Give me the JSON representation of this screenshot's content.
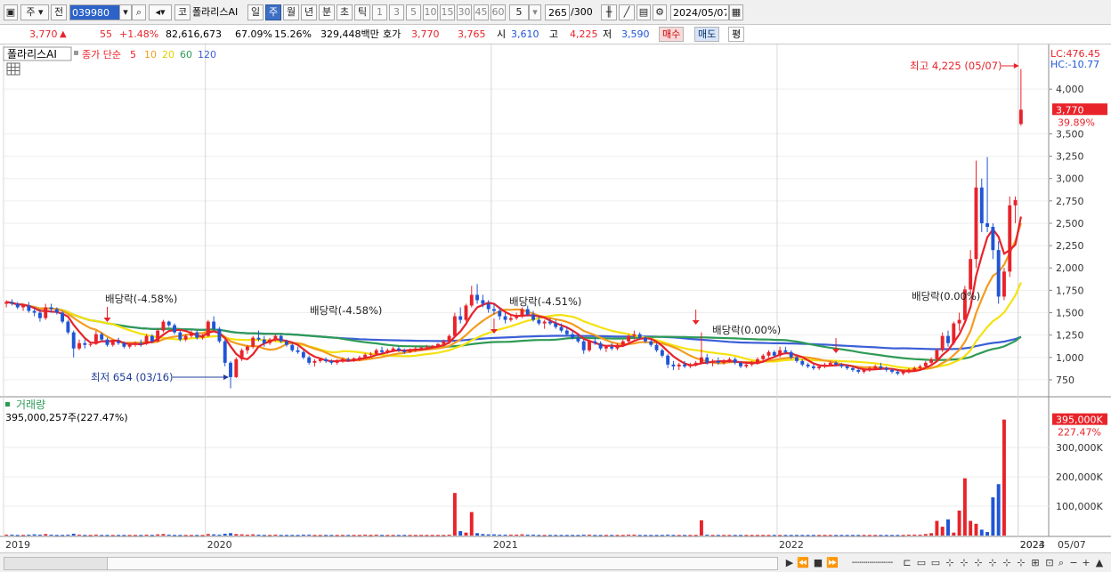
{
  "toolbar": {
    "market": "주",
    "jeon": "전",
    "code": "039980",
    "ko_label": "코",
    "stock_name": "폴라리스AI",
    "periods": [
      "일",
      "주",
      "월",
      "년",
      "분",
      "초",
      "틱"
    ],
    "active_period": "주",
    "intervals": [
      "1",
      "3",
      "5",
      "10",
      "15",
      "30",
      "45",
      "60"
    ],
    "interval_select": "5",
    "bar_count": "265",
    "bar_total": "/300",
    "date": "2024/05/07"
  },
  "quote": {
    "price": "3,770",
    "arrow": "▲",
    "change": "55",
    "change_pct": "+1.48%",
    "volume": "82,616,673",
    "vol_ratio": "67.09%",
    "turnover": "15.26%",
    "amount": "329,448백만",
    "hoga_label": "호가",
    "hoga1": "3,770",
    "hoga2": "3,765",
    "open_label": "시",
    "open": "3,610",
    "high_label": "고",
    "high": "4,225",
    "low_label": "저",
    "low": "3,590",
    "buy": "매수",
    "sell": "매도",
    "eval": "평"
  },
  "legend": {
    "name": "폴라리스AI",
    "ma_prefix": "종가 단순",
    "ma_periods": [
      "5",
      "10",
      "20",
      "60",
      "120"
    ],
    "lc": "LC:476.45",
    "hc": "HC:-10.77",
    "volume_title": "거래량",
    "volume_last": "395,000,257주(227.47%)"
  },
  "colors": {
    "up": "#e8232a",
    "down": "#1f55d6",
    "ma5": "#e8232a",
    "ma10": "#f39c1f",
    "ma20": "#f4e20f",
    "ma60": "#2e9b56",
    "ma120": "#3b5fd7"
  },
  "chart_data": {
    "type": "candlestick",
    "x_labels": [
      "2019",
      "2020",
      "2021",
      "2022",
      "2023",
      "2024",
      "05/07"
    ],
    "y_ticks": [
      "750",
      "1,000",
      "1,250",
      "1,500",
      "1,750",
      "2,000",
      "2,250",
      "2,500",
      "2,750",
      "3,000",
      "3,250",
      "3,500",
      "4,000"
    ],
    "ylim": [
      600,
      4300
    ],
    "current_price": "3,770",
    "current_pct": "39.89%",
    "annotations": [
      {
        "text": "최고 4,225 (05/07)",
        "value": 4225
      },
      {
        "text": "최저 654 (03/16)",
        "value": 654
      },
      {
        "text": "배당락(-4.58%)"
      },
      {
        "text": "배당락(-4.58%)"
      },
      {
        "text": "배당락(-4.51%)"
      },
      {
        "text": "배당락(0.00%)"
      },
      {
        "text": "배당락(0.00%)"
      }
    ],
    "volume_ticks": [
      "100,000K",
      "200,000K",
      "300,000K"
    ],
    "volume_last_label": "395,000K",
    "volume_last_pct": "227.47%",
    "volume_ylim": [
      0,
      400000
    ],
    "candles": [
      [
        1600,
        1640,
        1560,
        1620
      ],
      [
        1620,
        1650,
        1580,
        1600
      ],
      [
        1600,
        1620,
        1540,
        1560
      ],
      [
        1560,
        1600,
        1520,
        1580
      ],
      [
        1580,
        1620,
        1500,
        1520
      ],
      [
        1520,
        1560,
        1460,
        1500
      ],
      [
        1500,
        1540,
        1400,
        1440
      ],
      [
        1440,
        1600,
        1420,
        1560
      ],
      [
        1560,
        1600,
        1500,
        1540
      ],
      [
        1540,
        1560,
        1480,
        1500
      ],
      [
        1500,
        1520,
        1380,
        1400
      ],
      [
        1400,
        1420,
        1260,
        1280
      ],
      [
        1280,
        1300,
        1000,
        1100
      ],
      [
        1100,
        1200,
        1080,
        1160
      ],
      [
        1160,
        1200,
        1100,
        1140
      ],
      [
        1140,
        1160,
        1120,
        1150
      ],
      [
        1150,
        1300,
        1140,
        1260
      ],
      [
        1260,
        1280,
        1180,
        1200
      ],
      [
        1200,
        1220,
        1120,
        1140
      ],
      [
        1140,
        1200,
        1120,
        1180
      ],
      [
        1180,
        1220,
        1140,
        1160
      ],
      [
        1160,
        1180,
        1100,
        1120
      ],
      [
        1120,
        1160,
        1100,
        1140
      ],
      [
        1140,
        1180,
        1120,
        1160
      ],
      [
        1160,
        1200,
        1120,
        1150
      ],
      [
        1150,
        1260,
        1140,
        1240
      ],
      [
        1240,
        1260,
        1160,
        1180
      ],
      [
        1180,
        1320,
        1170,
        1300
      ],
      [
        1300,
        1420,
        1280,
        1400
      ],
      [
        1400,
        1410,
        1340,
        1360
      ],
      [
        1360,
        1380,
        1260,
        1280
      ],
      [
        1280,
        1300,
        1180,
        1200
      ],
      [
        1200,
        1260,
        1180,
        1240
      ],
      [
        1240,
        1300,
        1220,
        1280
      ],
      [
        1280,
        1300,
        1200,
        1220
      ],
      [
        1220,
        1260,
        1200,
        1240
      ],
      [
        1240,
        1420,
        1230,
        1400
      ],
      [
        1400,
        1460,
        1300,
        1320
      ],
      [
        1320,
        1340,
        1160,
        1180
      ],
      [
        1180,
        1200,
        900,
        940
      ],
      [
        940,
        960,
        654,
        780
      ],
      [
        780,
        1000,
        770,
        980
      ],
      [
        980,
        1100,
        960,
        1080
      ],
      [
        1080,
        1140,
        1040,
        1120
      ],
      [
        1120,
        1240,
        1100,
        1220
      ],
      [
        1220,
        1300,
        1180,
        1200
      ],
      [
        1200,
        1240,
        1120,
        1160
      ],
      [
        1160,
        1220,
        1140,
        1200
      ],
      [
        1200,
        1260,
        1180,
        1240
      ],
      [
        1240,
        1260,
        1160,
        1180
      ],
      [
        1180,
        1200,
        1120,
        1140
      ],
      [
        1140,
        1160,
        1060,
        1080
      ],
      [
        1080,
        1120,
        1040,
        1060
      ],
      [
        1060,
        1080,
        980,
        1000
      ],
      [
        1000,
        1020,
        920,
        940
      ],
      [
        940,
        980,
        900,
        960
      ],
      [
        960,
        1000,
        940,
        980
      ],
      [
        980,
        1000,
        940,
        960
      ],
      [
        960,
        980,
        920,
        940
      ],
      [
        940,
        980,
        920,
        960
      ],
      [
        960,
        1000,
        940,
        980
      ],
      [
        980,
        1000,
        950,
        970
      ],
      [
        970,
        1000,
        950,
        990
      ],
      [
        990,
        1020,
        960,
        1000
      ],
      [
        1000,
        1050,
        980,
        1030
      ],
      [
        1030,
        1060,
        1000,
        1040
      ],
      [
        1040,
        1100,
        1020,
        1080
      ],
      [
        1080,
        1120,
        1040,
        1060
      ],
      [
        1060,
        1100,
        1040,
        1080
      ],
      [
        1080,
        1120,
        1060,
        1100
      ],
      [
        1100,
        1120,
        1060,
        1080
      ],
      [
        1080,
        1100,
        1040,
        1060
      ],
      [
        1060,
        1100,
        1050,
        1090
      ],
      [
        1090,
        1120,
        1060,
        1100
      ],
      [
        1100,
        1120,
        1080,
        1110
      ],
      [
        1110,
        1140,
        1090,
        1120
      ],
      [
        1120,
        1140,
        1100,
        1130
      ],
      [
        1130,
        1160,
        1110,
        1150
      ],
      [
        1150,
        1200,
        1130,
        1180
      ],
      [
        1180,
        1260,
        1160,
        1240
      ],
      [
        1240,
        1500,
        1230,
        1460
      ],
      [
        1460,
        1560,
        1380,
        1420
      ],
      [
        1420,
        1600,
        1400,
        1580
      ],
      [
        1580,
        1800,
        1560,
        1700
      ],
      [
        1700,
        1820,
        1600,
        1640
      ],
      [
        1640,
        1700,
        1560,
        1600
      ],
      [
        1600,
        1640,
        1500,
        1540
      ],
      [
        1540,
        1600,
        1480,
        1520
      ],
      [
        1520,
        1560,
        1420,
        1460
      ],
      [
        1460,
        1500,
        1380,
        1420
      ],
      [
        1420,
        1480,
        1400,
        1440
      ],
      [
        1440,
        1500,
        1420,
        1470
      ],
      [
        1470,
        1560,
        1440,
        1540
      ],
      [
        1540,
        1580,
        1460,
        1480
      ],
      [
        1480,
        1520,
        1400,
        1420
      ],
      [
        1420,
        1460,
        1360,
        1380
      ],
      [
        1380,
        1420,
        1320,
        1400
      ],
      [
        1400,
        1440,
        1360,
        1380
      ],
      [
        1380,
        1420,
        1320,
        1340
      ],
      [
        1340,
        1380,
        1280,
        1300
      ],
      [
        1300,
        1340,
        1240,
        1260
      ],
      [
        1260,
        1300,
        1200,
        1220
      ],
      [
        1220,
        1260,
        1160,
        1180
      ],
      [
        1180,
        1200,
        1040,
        1080
      ],
      [
        1080,
        1200,
        1060,
        1180
      ],
      [
        1180,
        1220,
        1140,
        1160
      ],
      [
        1160,
        1180,
        1080,
        1100
      ],
      [
        1100,
        1140,
        1060,
        1120
      ],
      [
        1120,
        1160,
        1080,
        1100
      ],
      [
        1100,
        1160,
        1080,
        1140
      ],
      [
        1140,
        1200,
        1120,
        1180
      ],
      [
        1180,
        1260,
        1160,
        1240
      ],
      [
        1240,
        1300,
        1200,
        1260
      ],
      [
        1260,
        1280,
        1200,
        1220
      ],
      [
        1220,
        1240,
        1160,
        1180
      ],
      [
        1180,
        1200,
        1120,
        1140
      ],
      [
        1140,
        1160,
        1060,
        1080
      ],
      [
        1080,
        1100,
        1000,
        1020
      ],
      [
        1020,
        1040,
        880,
        920
      ],
      [
        920,
        960,
        860,
        900
      ],
      [
        900,
        940,
        860,
        920
      ],
      [
        920,
        960,
        880,
        900
      ],
      [
        900,
        940,
        880,
        920
      ],
      [
        920,
        960,
        900,
        940
      ],
      [
        940,
        1280,
        920,
        1000
      ],
      [
        1000,
        1040,
        920,
        940
      ],
      [
        940,
        980,
        900,
        960
      ],
      [
        960,
        1000,
        920,
        940
      ],
      [
        940,
        980,
        920,
        960
      ],
      [
        960,
        1000,
        940,
        980
      ],
      [
        980,
        1000,
        920,
        940
      ],
      [
        940,
        960,
        880,
        900
      ],
      [
        900,
        940,
        880,
        920
      ],
      [
        920,
        960,
        900,
        940
      ],
      [
        940,
        1000,
        920,
        980
      ],
      [
        980,
        1040,
        960,
        1020
      ],
      [
        1020,
        1080,
        1000,
        1060
      ],
      [
        1060,
        1080,
        1000,
        1020
      ],
      [
        1020,
        1120,
        1000,
        1080
      ],
      [
        1080,
        1120,
        1040,
        1060
      ],
      [
        1060,
        1080,
        980,
        1000
      ],
      [
        1000,
        1020,
        940,
        960
      ],
      [
        960,
        980,
        900,
        920
      ],
      [
        920,
        940,
        880,
        900
      ],
      [
        900,
        920,
        860,
        880
      ],
      [
        880,
        920,
        860,
        900
      ],
      [
        900,
        940,
        880,
        920
      ],
      [
        920,
        960,
        900,
        940
      ],
      [
        940,
        960,
        900,
        920
      ],
      [
        920,
        940,
        880,
        900
      ],
      [
        900,
        920,
        860,
        880
      ],
      [
        880,
        900,
        840,
        860
      ],
      [
        860,
        880,
        820,
        840
      ],
      [
        840,
        880,
        820,
        860
      ],
      [
        860,
        900,
        840,
        880
      ],
      [
        880,
        920,
        860,
        900
      ],
      [
        900,
        940,
        860,
        880
      ],
      [
        880,
        900,
        840,
        860
      ],
      [
        860,
        880,
        820,
        840
      ],
      [
        840,
        860,
        800,
        820
      ],
      [
        820,
        860,
        800,
        840
      ],
      [
        840,
        880,
        820,
        860
      ],
      [
        860,
        900,
        840,
        880
      ],
      [
        880,
        920,
        860,
        900
      ],
      [
        900,
        960,
        880,
        940
      ],
      [
        940,
        1000,
        920,
        980
      ],
      [
        980,
        1100,
        960,
        1080
      ],
      [
        1080,
        1280,
        1060,
        1240
      ],
      [
        1240,
        1300,
        1120,
        1160
      ],
      [
        1160,
        1400,
        1140,
        1380
      ],
      [
        1380,
        1500,
        1300,
        1420
      ],
      [
        1420,
        1800,
        1400,
        1760
      ],
      [
        1760,
        2200,
        1700,
        2100
      ],
      [
        2100,
        3200,
        2000,
        2900
      ],
      [
        2900,
        3000,
        2400,
        2500
      ],
      [
        2500,
        3240,
        2400,
        2460
      ],
      [
        2460,
        2500,
        2100,
        2200
      ],
      [
        2200,
        2300,
        1600,
        1680
      ],
      [
        1680,
        2000,
        1640,
        1960
      ],
      [
        1960,
        2800,
        1900,
        2700
      ],
      [
        2700,
        2800,
        2500,
        2760
      ],
      [
        3610,
        4225,
        3590,
        3770
      ]
    ],
    "volumes": [
      3000,
      3000,
      2000,
      2000,
      3000,
      4000,
      3000,
      5000,
      3000,
      2000,
      2000,
      3000,
      6000,
      3000,
      2000,
      2000,
      3000,
      2000,
      2000,
      2000,
      2000,
      2000,
      2000,
      2000,
      2000,
      3000,
      2000,
      4000,
      5000,
      3000,
      2000,
      2000,
      2000,
      2000,
      2000,
      2000,
      5000,
      4000,
      3000,
      6000,
      8000,
      5000,
      4000,
      3000,
      4000,
      3000,
      2000,
      2000,
      3000,
      2000,
      2000,
      2000,
      2000,
      3000,
      3000,
      2000,
      2000,
      2000,
      2000,
      2000,
      2000,
      2000,
      2000,
      2000,
      3000,
      2000,
      3000,
      2000,
      2000,
      2000,
      2000,
      2000,
      2000,
      2000,
      2000,
      2000,
      2000,
      2000,
      2000,
      3000,
      145000,
      15000,
      10000,
      80000,
      8000,
      5000,
      4000,
      4000,
      3000,
      3000,
      3000,
      3000,
      4000,
      3000,
      3000,
      2000,
      2000,
      2000,
      2000,
      2000,
      2000,
      2000,
      2000,
      3000,
      3000,
      2000,
      2000,
      2000,
      2000,
      2000,
      2000,
      3000,
      3000,
      2000,
      2000,
      2000,
      2000,
      2000,
      3000,
      2000,
      2000,
      2000,
      2000,
      2000,
      52000,
      3000,
      2000,
      2000,
      2000,
      2000,
      2000,
      2000,
      2000,
      2000,
      2000,
      2000,
      2000,
      2000,
      2000,
      2000,
      2000,
      2000,
      2000,
      2000,
      2000,
      2000,
      2000,
      2000,
      2000,
      2000,
      2000,
      2000,
      2000,
      2000,
      2000,
      2000,
      2000,
      2000,
      2000,
      2000,
      2000,
      3000,
      3000,
      3000,
      5000,
      8000,
      50000,
      30000,
      55000,
      10000,
      85000,
      195000,
      50000,
      40000,
      20000,
      12000,
      130000,
      175000,
      395000
    ]
  }
}
